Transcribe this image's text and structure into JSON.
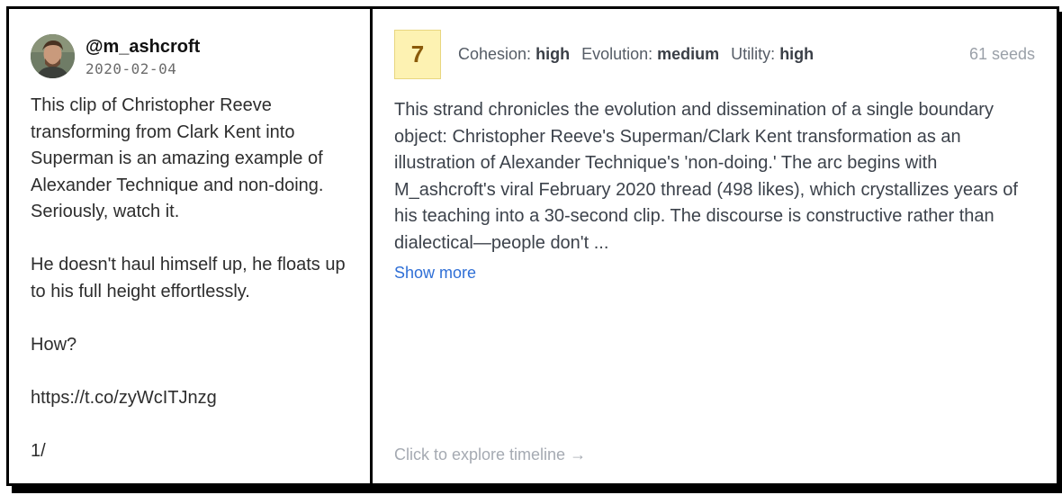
{
  "tweet": {
    "handle": "@m_ashcroft",
    "date": "2020-02-04",
    "paragraphs": [
      "This clip of Christopher Reeve transforming from Clark Kent into Superman is an amazing example of Alexander Technique and non-doing. Seriously, watch it.",
      "He doesn't haul himself up, he floats up to his full height effortlessly.",
      "How?",
      "https://t.co/zyWcITJnzg",
      "1/"
    ]
  },
  "strand": {
    "score": "7",
    "metrics": [
      {
        "label": "Cohesion:",
        "value": "high"
      },
      {
        "label": "Evolution:",
        "value": "medium"
      },
      {
        "label": "Utility:",
        "value": "high"
      }
    ],
    "seeds": "61 seeds",
    "summary": "This strand chronicles the evolution and dissemination of a single boundary object: Christopher Reeve's Superman/Clark Kent transformation as an illustration of Alexander Technique's 'non-doing.' The arc begins with M_ashcroft's viral February 2020 thread (498 likes), which crystallizes years of his teaching into a 30-second clip. The discourse is constructive rather than dialectical—people don't ...",
    "show_more": "Show more",
    "explore": "Click to explore timeline →"
  },
  "colors": {
    "score_bg": "#fdf2b2",
    "score_text": "#8a5a0a",
    "link": "#2f6fd6"
  }
}
